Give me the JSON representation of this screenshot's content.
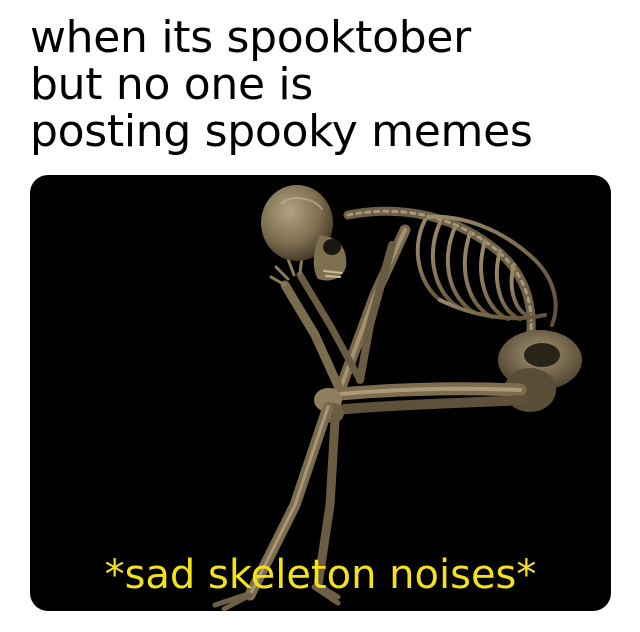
{
  "meme": {
    "top_caption_lines": [
      "when its spooktober",
      "but no one is",
      "posting spooky memes"
    ],
    "bottom_caption": "*sad skeleton noises*",
    "colors": {
      "page_background": "#ffffff",
      "top_text": "#000000",
      "panel_background": "#000000",
      "bottom_text": "#f3e21a",
      "bone": "#8a7a5c"
    }
  }
}
